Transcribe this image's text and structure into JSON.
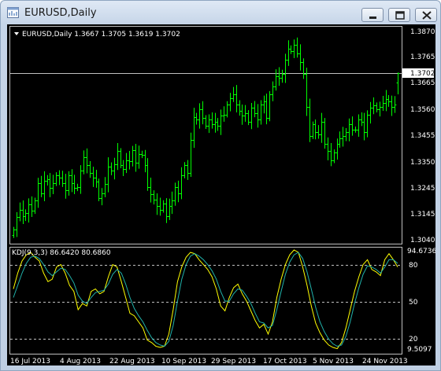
{
  "window": {
    "title": "EURUSD,Daily",
    "buttons": [
      "minimize",
      "restore",
      "close"
    ]
  },
  "main_chart": {
    "header": "EURUSD,Daily  1.3667 1.3705 1.3619 1.3702",
    "current_price_label": "1.3702",
    "price_axis_labels": [
      "1.3870",
      "1.3765",
      "1.3665",
      "1.3560",
      "1.3455",
      "1.3350",
      "1.3245",
      "1.3145",
      "1.3040"
    ]
  },
  "indicator": {
    "header": "KDJ(9,3,3) 86.6420 80.6860",
    "axis_labels": [
      "94.6736",
      "80",
      "50",
      "20",
      "9.5097"
    ]
  },
  "time_axis_labels": [
    "16 Jul 2013",
    "4 Aug 2013",
    "22 Aug 2013",
    "10 Sep 2013",
    "29 Sep 2013",
    "17 Oct 2013",
    "5 Nov 2013",
    "24 Nov 2013"
  ],
  "colors": {
    "background": "#000000",
    "bars": "#00ff00",
    "k_line": "#ffff00",
    "d_line": "#20b2aa",
    "text": "#ffffff",
    "grid": "#c0c0c0"
  },
  "chart_data": [
    {
      "type": "ohlc",
      "title": "EURUSD,Daily",
      "last_bar": {
        "open": 1.3667,
        "high": 1.3705,
        "low": 1.3619,
        "close": 1.3702
      },
      "ylim": [
        1.304,
        1.387
      ],
      "close_series": [
        1.3085,
        1.3135,
        1.3165,
        1.314,
        1.315,
        1.3185,
        1.316,
        1.32,
        1.327,
        1.323,
        1.328,
        1.3285,
        1.325,
        1.327,
        1.33,
        1.329,
        1.327,
        1.324,
        1.33,
        1.327,
        1.325,
        1.3255,
        1.332,
        1.337,
        1.334,
        1.331,
        1.329,
        1.3275,
        1.321,
        1.323,
        1.3265,
        1.3335,
        1.332,
        1.3345,
        1.3395,
        1.334,
        1.3325,
        1.336,
        1.3355,
        1.34,
        1.335,
        1.3385,
        1.338,
        1.334,
        1.3255,
        1.3225,
        1.3205,
        1.318,
        1.3165,
        1.319,
        1.314,
        1.318,
        1.32,
        1.3255,
        1.323,
        1.33,
        1.334,
        1.331,
        1.344,
        1.353,
        1.352,
        1.356,
        1.3525,
        1.3495,
        1.352,
        1.35,
        1.351,
        1.3495,
        1.3535,
        1.354,
        1.358,
        1.3605,
        1.362,
        1.358,
        1.3555,
        1.3535,
        1.3545,
        1.351,
        1.3565,
        1.3545,
        1.352,
        1.358,
        1.359,
        1.3525,
        1.362,
        1.365,
        1.369,
        1.3685,
        1.37,
        1.3755,
        1.38,
        1.379,
        1.3815,
        1.378,
        1.3745,
        1.37,
        1.357,
        1.3455,
        1.35,
        1.347,
        1.346,
        1.351,
        1.3425,
        1.3395,
        1.336,
        1.339,
        1.3425,
        1.3445,
        1.3455,
        1.347,
        1.35,
        1.348,
        1.348,
        1.352,
        1.351,
        1.347,
        1.354,
        1.3565,
        1.3575,
        1.356,
        1.357,
        1.3585,
        1.36,
        1.359,
        1.357,
        1.358,
        1.3702
      ]
    },
    {
      "type": "line",
      "title": "KDJ(9,3,3)",
      "ylim": [
        9.5097,
        94.6736
      ],
      "series": [
        {
          "name": "K",
          "values": [
            62,
            75,
            85,
            90,
            92,
            88,
            85,
            75,
            68,
            70,
            80,
            82,
            75,
            65,
            60,
            45,
            50,
            48,
            60,
            62,
            58,
            60,
            72,
            82,
            80,
            68,
            55,
            42,
            40,
            35,
            30,
            20,
            18,
            15,
            14,
            15,
            25,
            45,
            68,
            80,
            88,
            92,
            91,
            86,
            82,
            78,
            72,
            62,
            48,
            44,
            55,
            63,
            66,
            58,
            52,
            44,
            36,
            30,
            33,
            25,
            35,
            55,
            70,
            82,
            90,
            94,
            92,
            80,
            65,
            48,
            34,
            26,
            20,
            16,
            14,
            13,
            18,
            30,
            45,
            60,
            72,
            82,
            86,
            78,
            76,
            73,
            86,
            91,
            86,
            80
          ]
        },
        {
          "name": "D",
          "values": [
            55,
            65,
            75,
            83,
            88,
            89,
            87,
            82,
            76,
            73,
            76,
            79,
            78,
            73,
            67,
            57,
            52,
            50,
            55,
            59,
            60,
            61,
            66,
            74,
            78,
            75,
            66,
            55,
            46,
            40,
            35,
            28,
            22,
            18,
            16,
            15,
            19,
            32,
            52,
            70,
            82,
            89,
            91,
            89,
            86,
            82,
            77,
            70,
            60,
            52,
            52,
            58,
            62,
            61,
            56,
            50,
            42,
            35,
            34,
            30,
            32,
            45,
            60,
            74,
            84,
            90,
            92,
            87,
            76,
            62,
            47,
            35,
            27,
            21,
            17,
            15,
            16,
            23,
            35,
            50,
            63,
            74,
            81,
            80,
            78,
            75,
            80,
            86,
            86,
            83
          ]
        }
      ]
    }
  ]
}
